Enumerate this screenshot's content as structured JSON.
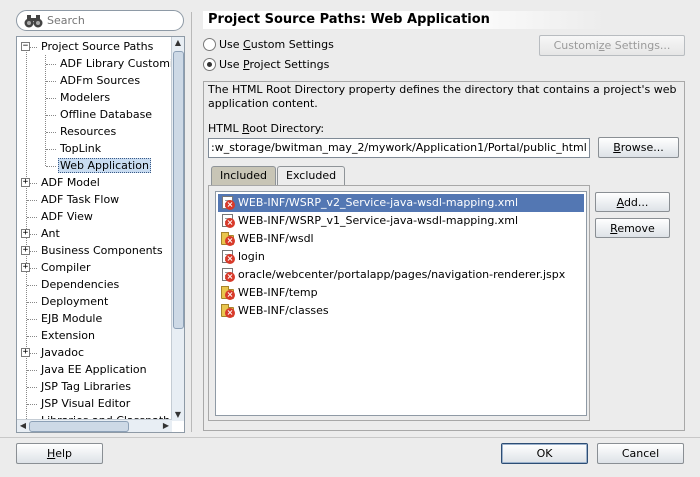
{
  "search": {
    "placeholder": "Search"
  },
  "tree": {
    "items": [
      {
        "label": "Project Source Paths",
        "level": 0,
        "expander": "minus"
      },
      {
        "label": "ADF Library Customi",
        "level": 1
      },
      {
        "label": "ADFm Sources",
        "level": 1
      },
      {
        "label": "Modelers",
        "level": 1
      },
      {
        "label": "Offline Database",
        "level": 1
      },
      {
        "label": "Resources",
        "level": 1
      },
      {
        "label": "TopLink",
        "level": 1
      },
      {
        "label": "Web Application",
        "level": 1,
        "selected": true
      },
      {
        "label": "ADF Model",
        "level": 0,
        "expander": "plus"
      },
      {
        "label": "ADF Task Flow",
        "level": 0
      },
      {
        "label": "ADF View",
        "level": 0
      },
      {
        "label": "Ant",
        "level": 0,
        "expander": "plus"
      },
      {
        "label": "Business Components",
        "level": 0,
        "expander": "plus"
      },
      {
        "label": "Compiler",
        "level": 0,
        "expander": "plus"
      },
      {
        "label": "Dependencies",
        "level": 0
      },
      {
        "label": "Deployment",
        "level": 0
      },
      {
        "label": "EJB Module",
        "level": 0
      },
      {
        "label": "Extension",
        "level": 0
      },
      {
        "label": "Javadoc",
        "level": 0,
        "expander": "plus"
      },
      {
        "label": "Java EE Application",
        "level": 0
      },
      {
        "label": "JSP Tag Libraries",
        "level": 0
      },
      {
        "label": "JSP Visual Editor",
        "level": 0
      },
      {
        "label": "Libraries and Classpath",
        "level": 0
      }
    ]
  },
  "panel": {
    "title": "Project Source Paths: Web Application",
    "radio_custom": "Use Custom Settings",
    "radio_project": "Use Project Settings",
    "customize_button": "Customize Settings...",
    "description": "The HTML Root Directory property defines the directory that contains a project's web application content.",
    "root_label": "HTML Root Directory:",
    "root_value": ":w_storage/bwitman_may_2/mywork/Application1/Portal/public_html",
    "browse_button": "Browse...",
    "tabs": {
      "included": "Included",
      "excluded": "Excluded"
    },
    "add_button": "Add...",
    "remove_button": "Remove",
    "entries": [
      {
        "path": "WEB-INF/WSRP_v2_Service-java-wsdl-mapping.xml",
        "icon": "file-icon",
        "selected": true
      },
      {
        "path": "WEB-INF/WSRP_v1_Service-java-wsdl-mapping.xml",
        "icon": "file-icon"
      },
      {
        "path": "WEB-INF/wsdl",
        "icon": "folder-icon"
      },
      {
        "path": "login",
        "icon": "file-icon"
      },
      {
        "path": "oracle/webcenter/portalapp/pages/navigation-renderer.jspx",
        "icon": "file-icon"
      },
      {
        "path": "WEB-INF/temp",
        "icon": "folder-icon"
      },
      {
        "path": "WEB-INF/classes",
        "icon": "folder-icon"
      }
    ]
  },
  "footer": {
    "help": "Help",
    "ok": "OK",
    "cancel": "Cancel"
  },
  "colors": {
    "selection": "#5377b3",
    "tree_selection": "#c9dcf1",
    "excluded_badge": "#d83a2a"
  }
}
